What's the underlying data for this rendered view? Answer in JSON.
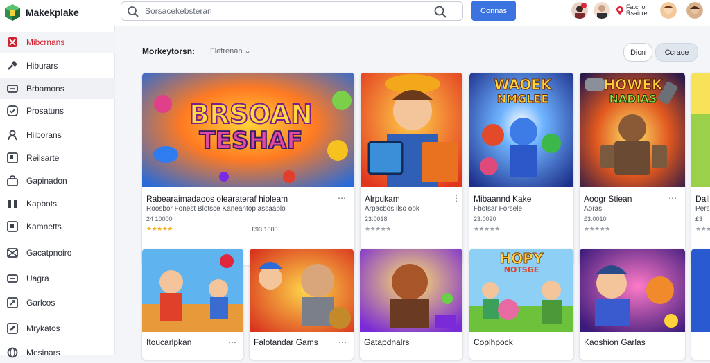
{
  "app": {
    "name": "Makekplake"
  },
  "search": {
    "placeholder": "Sorsacekebsteran"
  },
  "header": {
    "connect_label": "Connas",
    "promo_line1": "Fatchon",
    "promo_line2": "Rsaicre"
  },
  "sidebar": {
    "items": [
      {
        "label": "Mibcrnans",
        "icon": "tag-icon"
      },
      {
        "label": "Hiburars",
        "icon": "hammer-icon"
      },
      {
        "label": "Brbamons",
        "icon": "card-icon"
      },
      {
        "label": "Prosatuns",
        "icon": "badge-check-icon"
      },
      {
        "label": "Hiiborans",
        "icon": "user-icon"
      },
      {
        "label": "Reilsarte",
        "icon": "image-icon"
      },
      {
        "label": "Gapinadon",
        "icon": "bag-icon"
      },
      {
        "label": "Kapbots",
        "icon": "columns-icon"
      },
      {
        "label": "Kamnetts",
        "icon": "note-icon"
      },
      {
        "label": "Gacatpnoiro",
        "icon": "envelope-icon"
      },
      {
        "label": "Uagra",
        "icon": "minus-box-icon"
      },
      {
        "label": "Garlcos",
        "icon": "arrow-box-icon"
      },
      {
        "label": "Mrykatos",
        "icon": "pencil-box-icon"
      },
      {
        "label": "Mesinars",
        "icon": "globe-icon"
      }
    ]
  },
  "main": {
    "title": "Morkeytorsn:",
    "filter": "Fletrenan",
    "view_label": "Dicn",
    "create_label": "Ccrace",
    "row1": [
      {
        "title": "Rabearaimadaoos olearateraf hioleam",
        "subtitle": "Roosbor Fonest Blotsce Kaneantop assaablo",
        "count": "24 10000",
        "stars": "★★★★★",
        "price": "£93.1000",
        "art": "BRSOAN\nTESHAF"
      },
      {
        "title": "Alrpukam",
        "subtitle": "Arpacbos ilso ook",
        "count": "23.0018",
        "stars": "★★★★★",
        "art": ""
      },
      {
        "title": "Mibaannd Kake",
        "subtitle": "Fbotsar Forsele",
        "count": "23.0020",
        "stars": "★★★★★",
        "art": "WAOEK\nNMGLEE"
      },
      {
        "title": "Aoogr Stiean",
        "subtitle": "Aoras",
        "count": "£3.0010",
        "stars": "★★★★★",
        "art": "HOWEK\nNADIAS"
      },
      {
        "title": "Dall",
        "subtitle": "Pers",
        "count": "£3",
        "stars": "★★★",
        "art": ""
      }
    ],
    "row2": [
      {
        "title": "Itoucarlpkan",
        "art": ""
      },
      {
        "title": "Falotandar Gams",
        "art": ""
      },
      {
        "title": "Gatapdnalrs",
        "art": ""
      },
      {
        "title": "Coplhpock",
        "art": "HOPY\nNOTSGE"
      },
      {
        "title": "Kaoshion Garlas",
        "art": ""
      },
      {
        "title": "",
        "art": ""
      }
    ]
  },
  "colors": {
    "accent": "#3b73e0",
    "active_sidebar": "#d0202e",
    "star": "#f2b01e"
  }
}
